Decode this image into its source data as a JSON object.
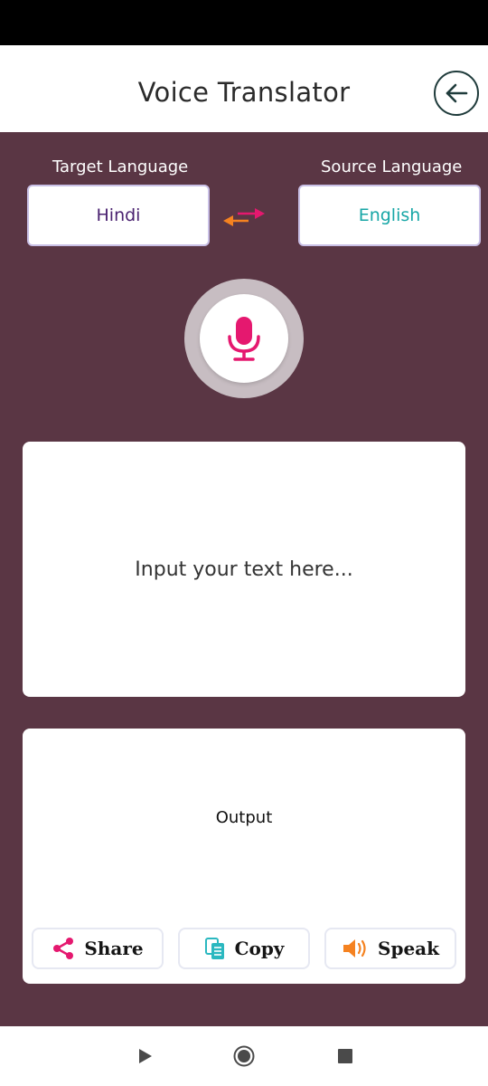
{
  "header": {
    "title": "Voice Translator",
    "back_icon": "arrow-left-circle-icon"
  },
  "languages": {
    "target_label": "Target Language",
    "source_label": "Source Language",
    "target_value": "Hindi",
    "source_value": "English",
    "swap_icon": "swap-arrows-icon"
  },
  "mic": {
    "icon": "microphone-icon"
  },
  "input": {
    "placeholder": "Input your text here..."
  },
  "output": {
    "label": "Output",
    "actions": {
      "share": "Share",
      "copy": "Copy",
      "speak": "Speak"
    }
  },
  "colors": {
    "background": "#5a3644",
    "accent_pink": "#e5186f",
    "accent_orange": "#f58220",
    "accent_teal": "#17a6a6",
    "target_text": "#4a2270"
  }
}
